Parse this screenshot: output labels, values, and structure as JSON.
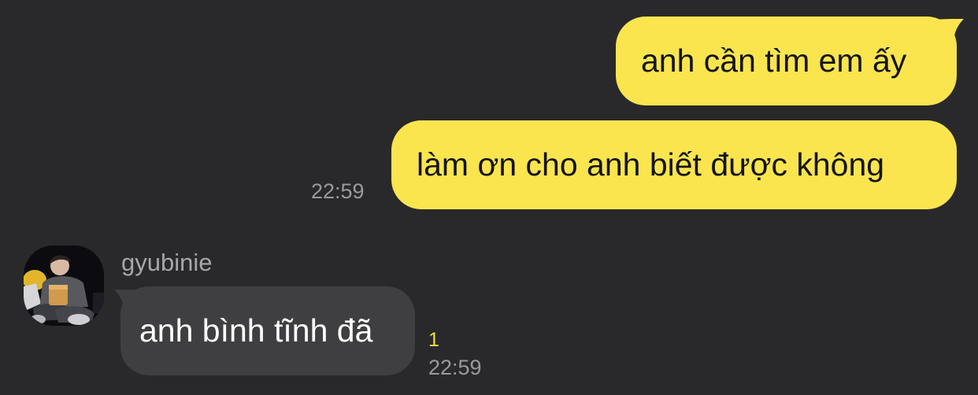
{
  "chat": {
    "outgoing": [
      {
        "text": "anh cần tìm em ấy"
      },
      {
        "text": "làm ơn cho anh biết được không",
        "time": "22:59"
      }
    ],
    "incoming": {
      "sender": "gyubinie",
      "avatar_icon": "profile-photo-avatar",
      "text": "anh bình tĩnh đã",
      "unread_count": "1",
      "time": "22:59"
    }
  },
  "colors": {
    "background": "#29292b",
    "outgoing_bubble": "#fae54f",
    "incoming_bubble": "#3f3f41",
    "unread_indicator": "#f5df3d"
  }
}
